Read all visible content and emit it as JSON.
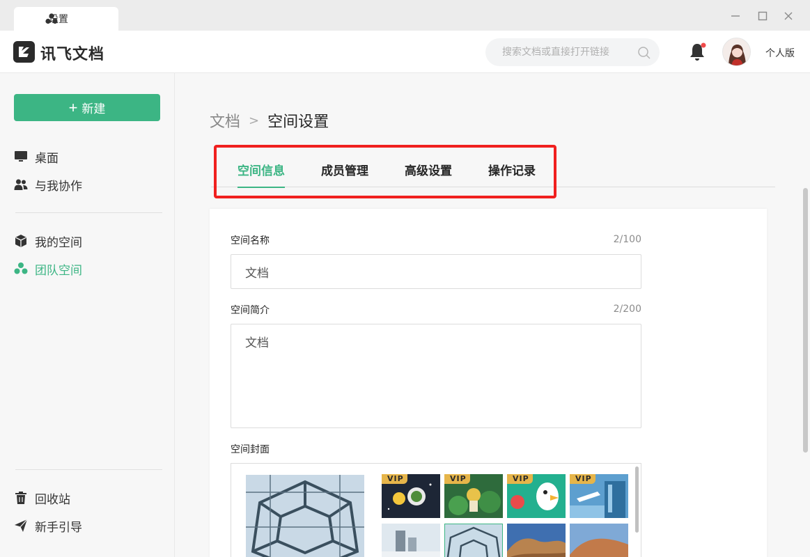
{
  "window": {
    "tab_label": "设置",
    "tab_icon": "team-icon"
  },
  "header": {
    "logo_text": "讯飞文档",
    "search_placeholder": "搜索文档或直接打开链接",
    "edition": "个人版"
  },
  "sidebar": {
    "new_label": "新建",
    "items": [
      {
        "label": "桌面",
        "icon": "desktop-icon"
      },
      {
        "label": "与我协作",
        "icon": "collab-icon"
      },
      {
        "label": "我的空间",
        "icon": "cube-icon"
      },
      {
        "label": "团队空间",
        "icon": "team-icon"
      },
      {
        "label": "回收站",
        "icon": "trash-icon"
      },
      {
        "label": "新手引导",
        "icon": "send-icon"
      }
    ]
  },
  "breadcrumb": {
    "parent": "文档",
    "separator": ">",
    "current": "空间设置"
  },
  "tabs": [
    {
      "label": "空间信息",
      "active": true
    },
    {
      "label": "成员管理",
      "active": false
    },
    {
      "label": "高级设置",
      "active": false
    },
    {
      "label": "操作记录",
      "active": false
    }
  ],
  "form": {
    "name_label": "空间名称",
    "name_counter": "2/100",
    "name_value": "文档",
    "desc_label": "空间简介",
    "desc_counter": "2/200",
    "desc_value": "文档",
    "cover_label": "空间封面",
    "vip_badge": "VIP"
  },
  "colors": {
    "accent": "#3cb584",
    "highlight": "#f0201f"
  }
}
